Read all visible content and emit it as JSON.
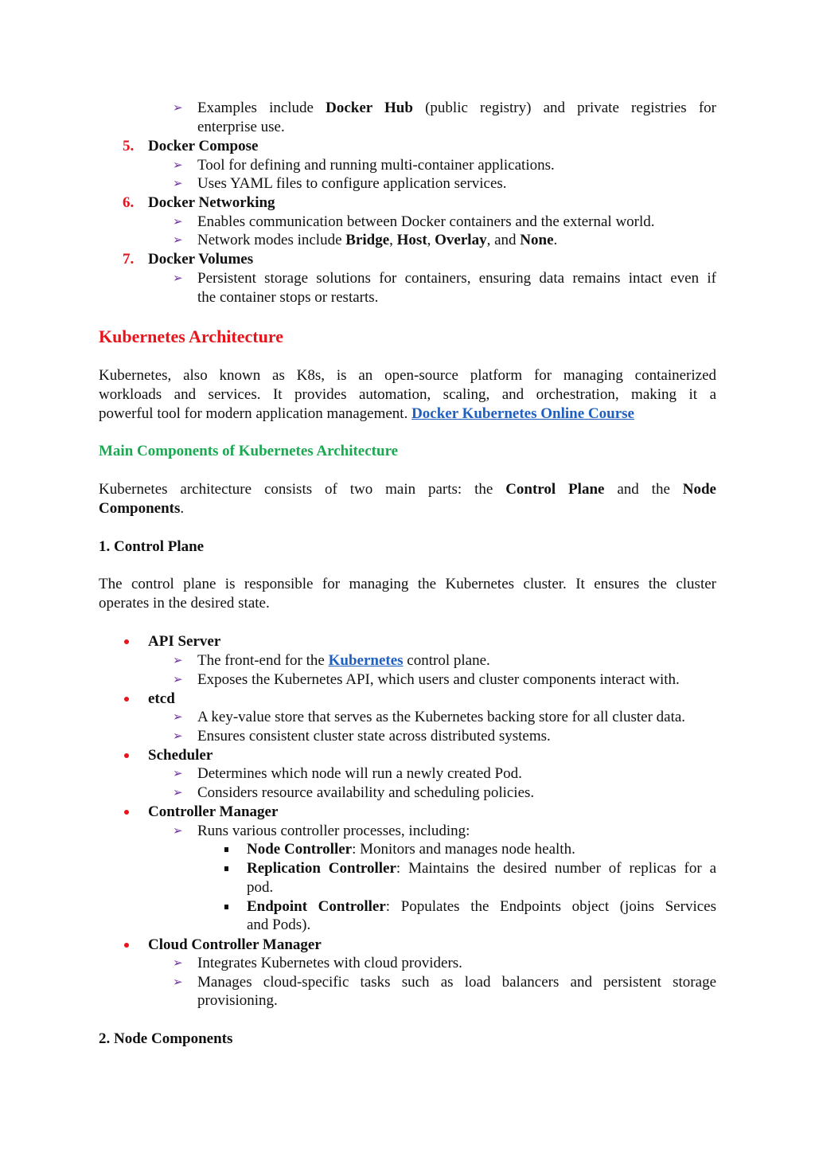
{
  "colors": {
    "heading_red": "#e8141b",
    "heading_green": "#1aa851",
    "arrow_purple": "#7030a0",
    "link_blue": "#1f5fbf"
  },
  "top_list": {
    "cont_item": {
      "pre": "Examples include ",
      "bold": "Docker Hub",
      "post_line1": " (public registry) and private registries for",
      "line2": "enterprise use."
    },
    "items": [
      {
        "num": "5.",
        "title": "Docker Compose",
        "bullets": [
          "Tool for defining and running multi-container applications.",
          "Uses YAML files to configure application services."
        ]
      },
      {
        "num": "6.",
        "title": "Docker Networking",
        "bullets": [
          "Enables communication between Docker containers and the external world."
        ],
        "network_modes": {
          "pre": "Network modes include ",
          "b1": "Bridge",
          "b2": "Host",
          "b3": "Overlay",
          "b4": "None",
          "sep": ", ",
          "and": ", and ",
          "end": "."
        }
      },
      {
        "num": "7.",
        "title": "Docker Volumes",
        "bullets": [
          "Persistent storage solutions for containers, ensuring data remains intact even if",
          "the container stops or restarts."
        ]
      }
    ]
  },
  "k8s": {
    "heading": "Kubernetes Architecture",
    "intro_line1": "Kubernetes, also known as K8s, is an open-source platform for managing containerized",
    "intro_line2": "workloads and services. It provides automation, scaling, and orchestration, making it a",
    "intro_line3": "powerful tool for modern application management. ",
    "intro_link": "Docker Kubernetes Online Course",
    "sub_heading": "Main Components of Kubernetes Architecture",
    "parts": {
      "pre": "Kubernetes architecture consists of two main parts: the ",
      "b1": "Control Plane",
      "mid": " and the ",
      "b2": "Node",
      "b3": "Components",
      "end": "."
    },
    "control_plane": {
      "heading": "1. Control Plane",
      "desc_line1": "The control plane is responsible for managing the Kubernetes cluster. It ensures the cluster",
      "desc_line2": "operates in the desired state.",
      "api": {
        "title": "API Server",
        "b1_pre": "The front-end for the ",
        "b1_link": "Kubernetes",
        "b1_post": " control plane.",
        "b2": "Exposes the Kubernetes API, which users and cluster components interact with."
      },
      "etcd": {
        "title": "etcd",
        "b1": "A key-value store that serves as the Kubernetes backing store for all cluster data.",
        "b2": "Ensures consistent cluster state across distributed systems."
      },
      "scheduler": {
        "title": "Scheduler",
        "b1": "Determines which node will run a newly created Pod.",
        "b2": "Considers resource availability and scheduling policies."
      },
      "controller": {
        "title": "Controller Manager",
        "b1": "Runs various controller processes, including:",
        "subs": [
          {
            "bold": "Node Controller",
            "text": ": Monitors and manages node health."
          },
          {
            "bold": "Replication Controller",
            "text": ": Maintains the desired number of replicas for a",
            "cont": "pod."
          },
          {
            "bold": "Endpoint Controller",
            "text": ": Populates the Endpoints object (joins Services",
            "cont": "and Pods)."
          }
        ]
      },
      "cloud": {
        "title": "Cloud Controller Manager",
        "b1": "Integrates Kubernetes with cloud providers.",
        "b2_line1": "Manages cloud-specific tasks such as load balancers and persistent storage",
        "b2_line2": "provisioning."
      }
    },
    "node_heading": "2. Node Components"
  }
}
